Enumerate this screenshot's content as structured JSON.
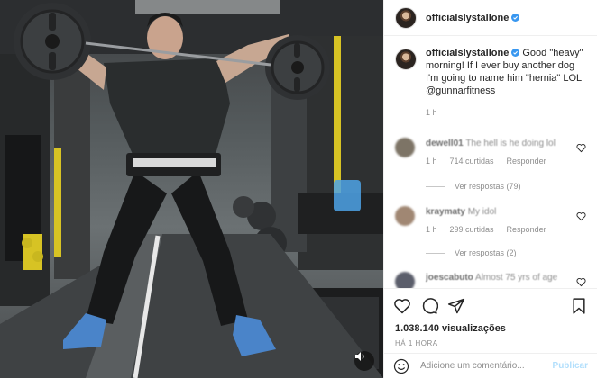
{
  "post": {
    "username": "officialslystallone",
    "caption": {
      "username": "officialslystallone",
      "text": "Good \"heavy\" morning! If I ever buy another dog I'm going to name him \"hernia\" LOL @gunnarfitness",
      "time": "1 h"
    },
    "comments": [
      {
        "user": "dewell01",
        "text": "The hell is he doing lol",
        "time": "1 h",
        "likes": "714 curtidas",
        "reply": "Responder",
        "replies": "Ver respostas (79)"
      },
      {
        "user": "kraymaty",
        "text": "My idol",
        "time": "1 h",
        "likes": "299 curtidas",
        "reply": "Responder",
        "replies": "Ver respostas (2)"
      },
      {
        "user": "joescabuto",
        "text": "Almost 75 yrs of age",
        "time": "",
        "likes": "",
        "reply": "",
        "replies": ""
      }
    ],
    "likes_count": "1.038.140 visualizações",
    "time_ago": "HÁ 1 HORA",
    "comment_placeholder": "Adicione um comentário...",
    "publish_label": "Publicar"
  },
  "colors": {
    "verified": "#3897f0",
    "publish_disabled": "#b2dffc",
    "secondary_text": "#8e8e8e"
  },
  "icons": {
    "media_sound": "speaker-icon",
    "verified": "verified-badge-icon",
    "actions": [
      "heart-icon",
      "comment-icon",
      "share-icon",
      "bookmark-icon"
    ],
    "comment_emoji": "emoji-icon"
  }
}
